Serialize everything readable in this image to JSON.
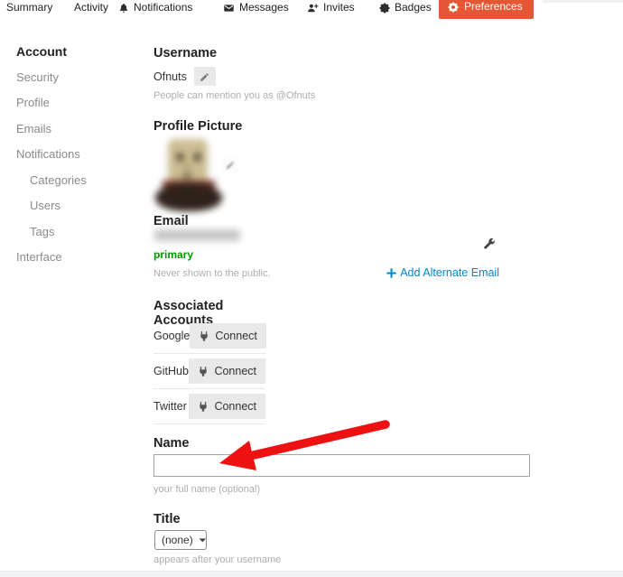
{
  "nav": {
    "items": [
      {
        "label": "Summary"
      },
      {
        "label": "Activity"
      },
      {
        "label": "Notifications",
        "icon": "bell-icon"
      },
      {
        "label": "Messages",
        "icon": "envelope-icon"
      },
      {
        "label": "Invites",
        "icon": "user-plus-icon"
      },
      {
        "label": "Badges",
        "icon": "certificate-icon"
      },
      {
        "label": "Preferences",
        "icon": "gear-icon",
        "active": true
      }
    ]
  },
  "sidebar": {
    "items": [
      {
        "label": "Account",
        "active": true
      },
      {
        "label": "Security"
      },
      {
        "label": "Profile"
      },
      {
        "label": "Emails"
      },
      {
        "label": "Notifications"
      },
      {
        "label": "Categories",
        "indent": true
      },
      {
        "label": "Users",
        "indent": true
      },
      {
        "label": "Tags",
        "indent": true
      },
      {
        "label": "Interface"
      }
    ]
  },
  "username": {
    "heading": "Username",
    "value": "Ofnuts",
    "hint": "People can mention you as @Ofnuts"
  },
  "profile_picture": {
    "heading": "Profile Picture",
    "image_state": "blurred avatar photo"
  },
  "email": {
    "heading": "Email",
    "address_state": "blurred email address",
    "badge": "primary",
    "privacy_note": "Never shown to the public.",
    "add_alternate_label": "Add Alternate Email"
  },
  "associated_accounts": {
    "heading": "Associated Accounts",
    "rows": [
      {
        "provider": "Google",
        "button_label": "Connect"
      },
      {
        "provider": "GitHub",
        "button_label": "Connect"
      },
      {
        "provider": "Twitter",
        "button_label": "Connect"
      }
    ]
  },
  "name_field": {
    "heading": "Name",
    "value": "",
    "hint": "your full name (optional)"
  },
  "title_field": {
    "heading": "Title",
    "selected": "(none)",
    "hint": "appears after your username"
  },
  "annotation": {
    "type": "red-arrow",
    "points_at": "name-input"
  },
  "colors": {
    "nav_active_bg": "#e45735",
    "link_blue": "#0088cc",
    "success_green": "#009900",
    "arrow_red": "#ed1111",
    "button_gray": "#e9e9e9",
    "border_light": "#e9e9e9",
    "text_muted": "#aeaeae"
  },
  "icons": {
    "bell-icon": "notification bell",
    "envelope-icon": "messages envelope",
    "user-plus-icon": "invite person with plus",
    "certificate-icon": "badge starburst",
    "gear-icon": "preferences cog",
    "pencil-icon": "edit pencil",
    "wrench-icon": "manage email wrench",
    "plus-icon": "blue plus",
    "plug-icon": "connect plug",
    "caret-down-icon": "dropdown caret"
  }
}
